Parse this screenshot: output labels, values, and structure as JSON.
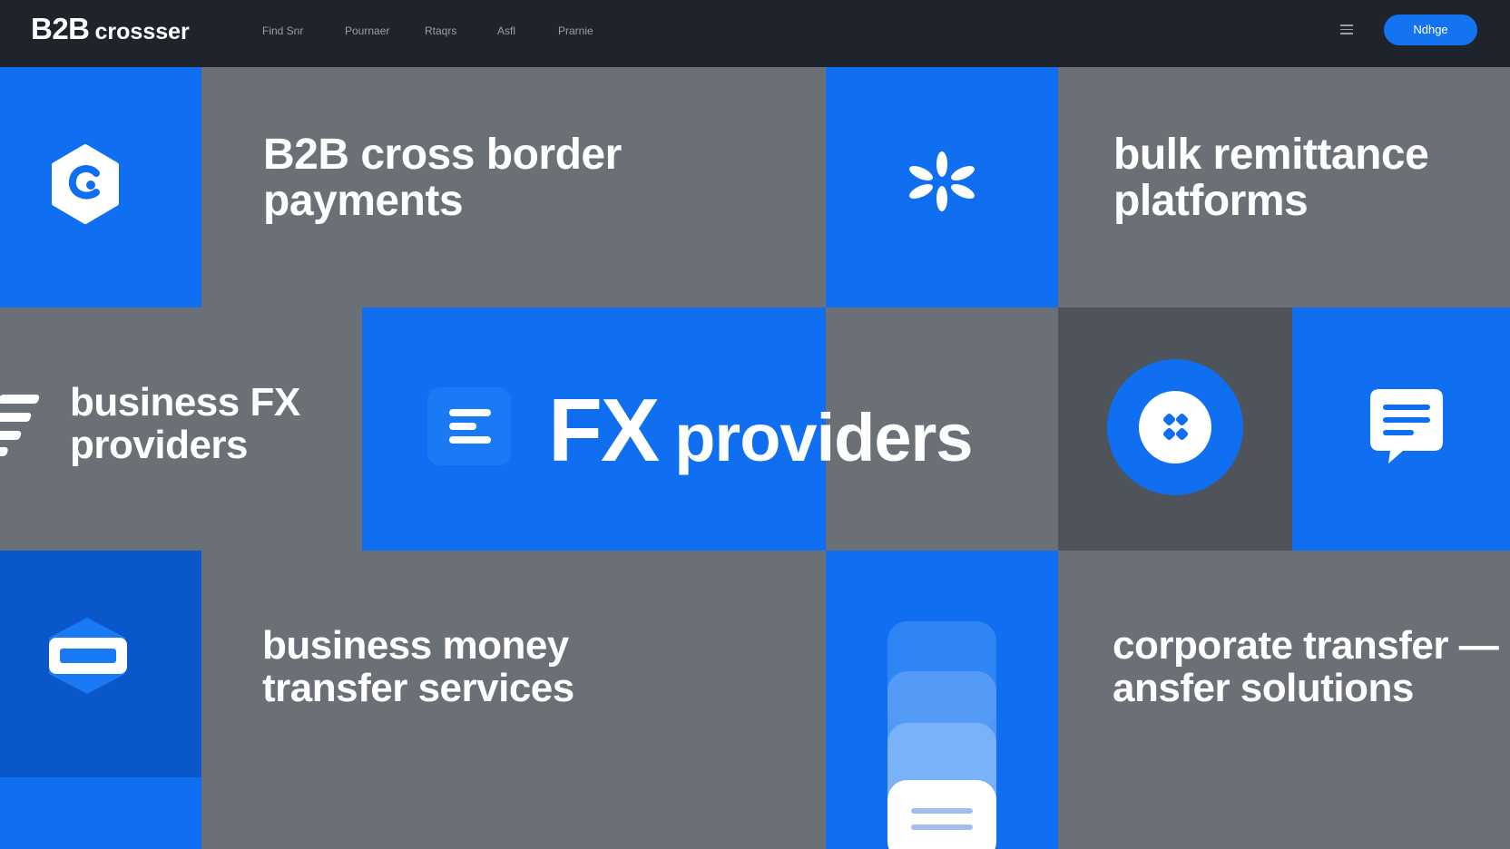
{
  "header": {
    "brand_main": "B2B",
    "brand_rest": "crossser",
    "nav": [
      "Find Snr",
      "Pournaer",
      "Rtaqrs",
      "Asfl",
      "Prarnie"
    ],
    "cta_label": "Ndhge"
  },
  "tiles": {
    "b2b_payments": "B2B cross border payments",
    "bulk_remittance": "bulk remittance platforms",
    "business_fx": "business FX providers",
    "fx_word1": "FX",
    "fx_word2": "providers",
    "money_transfer": "business money transfer services",
    "corporate_transfer": "corporate transfer —ansfer solutions"
  },
  "colors": {
    "accent": "#0f6ff0",
    "accent_deep": "#0a57c9",
    "tile_grey": "#6b6f76",
    "tile_dark": "#4f535a",
    "topbar": "#1f232b"
  },
  "icons": [
    "hexagon-logo-icon",
    "asterisk-icon",
    "list-icon",
    "cluster-circle-icon",
    "chat-bubble-icon",
    "card-icon",
    "stacked-cards-icon",
    "speed-lines-icon"
  ]
}
